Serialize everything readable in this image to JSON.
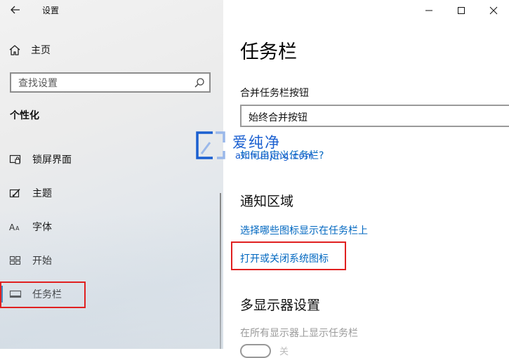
{
  "titlebar": {
    "app_title": "设置"
  },
  "sidebar": {
    "home_label": "主页",
    "search_placeholder": "查找设置",
    "section_title": "个性化",
    "items": [
      {
        "label": "锁屏界面",
        "icon": "lock-screen-icon"
      },
      {
        "label": "主题",
        "icon": "theme-brush-icon"
      },
      {
        "label": "字体",
        "icon": "font-icon"
      },
      {
        "label": "开始",
        "icon": "start-grid-icon"
      },
      {
        "label": "任务栏",
        "icon": "taskbar-icon",
        "selected": true
      }
    ]
  },
  "main": {
    "page_title": "任务栏",
    "combine_label": "合并任务栏按钮",
    "combine_value": "始终合并按钮",
    "customize_link": "如何自定义任务栏?",
    "notification_heading": "通知区域",
    "select_icons_link": "选择哪些图标显示在任务栏上",
    "system_icons_link": "打开或关闭系统图标",
    "multi_display_heading": "多显示器设置",
    "show_all_displays_label": "在所有显示器上显示任务栏",
    "toggle_state_label": "关"
  },
  "watermark": {
    "cn": "爱纯净",
    "en": "aichunjing.com"
  },
  "colors": {
    "link": "#0067c0",
    "highlight_box": "#e02020",
    "accent": "#0063b1"
  }
}
